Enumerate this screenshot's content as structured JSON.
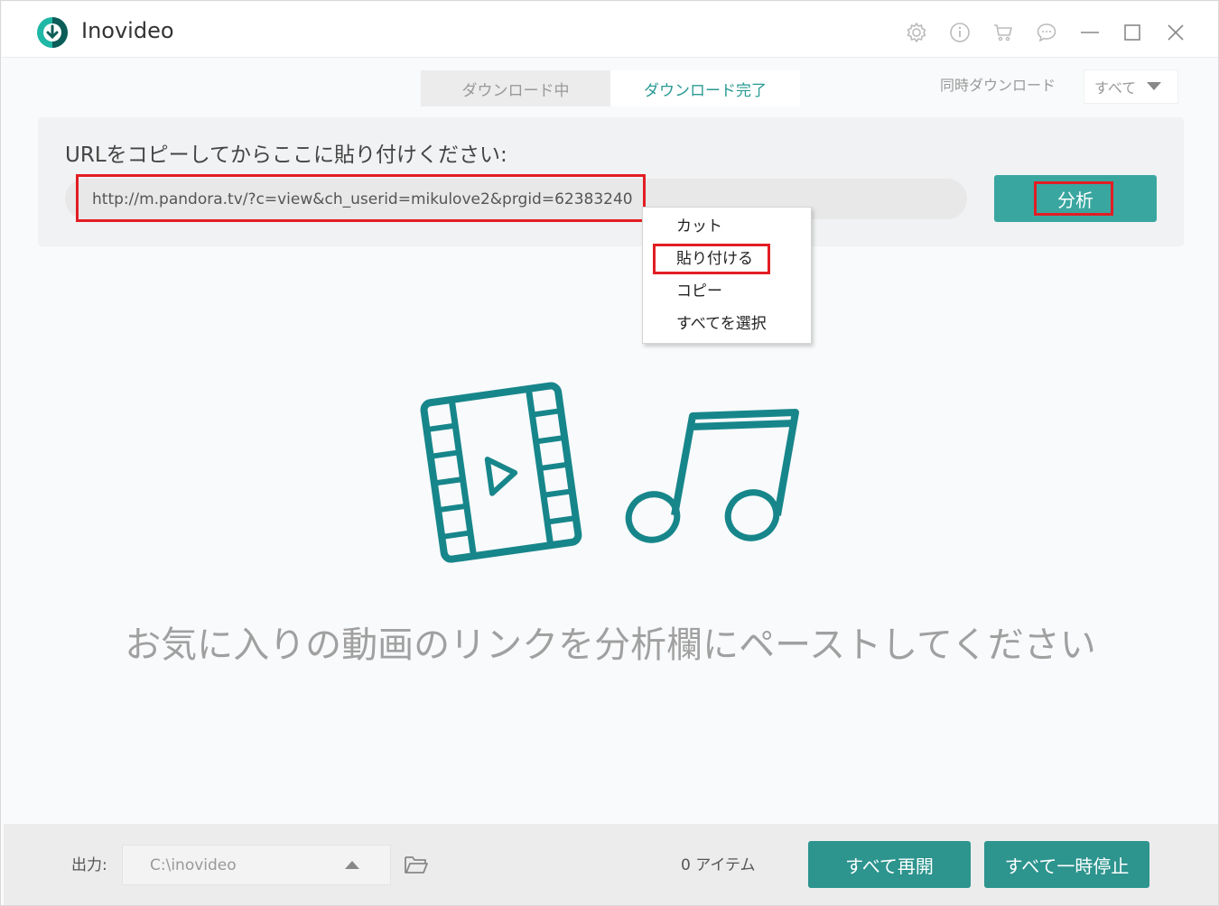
{
  "app": {
    "title": "Inovideo",
    "accent": "#2a9a94"
  },
  "titlebar": {
    "icons": [
      "gear-icon",
      "info-icon",
      "cart-icon",
      "chat-icon",
      "minimize-icon",
      "maximize-icon",
      "close-icon"
    ]
  },
  "tabs": [
    {
      "label": "ダウンロード中",
      "active": false
    },
    {
      "label": "ダウンロード完了",
      "active": true
    }
  ],
  "concurrent": {
    "label": "同時ダウンロード",
    "selected": "すべて"
  },
  "url_panel": {
    "prompt": "URLをコピーしてからここに貼り付けください:",
    "value": "http://m.pandora.tv/?c=view&ch_userid=mikulove2&prgid=62383240",
    "analyze_label": "分析"
  },
  "context_menu": {
    "items": [
      "カット",
      "貼り付ける",
      "コピー",
      "すべてを選択"
    ]
  },
  "empty_hint": "お気に入りの動画のリンクを分析欄にペーストしてください",
  "footer": {
    "output_label": "出力:",
    "output_path": "C:\\inovideo",
    "item_count": "0 アイテム",
    "resume_all": "すべて再開",
    "pause_all": "すべて一時停止"
  },
  "colors": {
    "highlight": "#e21d24",
    "button": "#3aa6a0",
    "footer_button": "#2d948e"
  }
}
